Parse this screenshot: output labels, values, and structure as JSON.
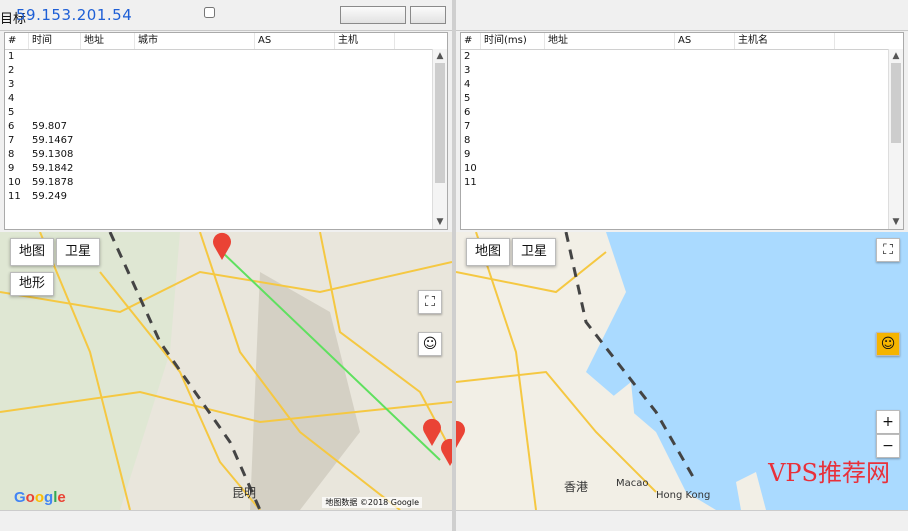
{
  "left": {
    "target_label": "目标",
    "target_ip": "59.153.201.54",
    "option_label": "",
    "buttons": {
      "trace": "",
      "stop": ""
    },
    "table": {
      "headers": [
        "#",
        "时间",
        "地址",
        "城市",
        "AS",
        "主机"
      ],
      "rows": [
        [
          "1",
          "",
          "",
          "",
          "",
          ""
        ],
        [
          "2",
          "",
          "",
          "",
          "",
          ""
        ],
        [
          "3",
          "",
          "",
          "",
          "",
          ""
        ],
        [
          "4",
          "",
          "",
          "",
          "",
          ""
        ],
        [
          "5",
          "",
          "",
          "",
          "",
          ""
        ],
        [
          "6",
          "59.807",
          "",
          "",
          "",
          ""
        ],
        [
          "7",
          "59.1467",
          "",
          "",
          "",
          ""
        ],
        [
          "8",
          "59.1308",
          "",
          "",
          "",
          ""
        ],
        [
          "9",
          "59.1842",
          "",
          "",
          "",
          ""
        ],
        [
          "10",
          "59.1878",
          "",
          "",
          "",
          ""
        ],
        [
          "11",
          "59.249",
          "",
          "",
          "",
          ""
        ]
      ]
    },
    "map": {
      "map_button": "地图",
      "satellite_button": "卫星",
      "terrain_label": "地形",
      "cities": [
        "昆明"
      ],
      "copyright": "地图数据 ©2018 Google",
      "status": ""
    }
  },
  "right": {
    "title": "",
    "mid_text": "",
    "right_text": "",
    "table": {
      "headers": [
        "#",
        "时间(ms)",
        "地址",
        "AS",
        "主机名"
      ],
      "rows": [
        [
          "2",
          "",
          "",
          "",
          ""
        ],
        [
          "3",
          "",
          "",
          "",
          ""
        ],
        [
          "4",
          "",
          "",
          "",
          ""
        ],
        [
          "5",
          "",
          "",
          "",
          ""
        ],
        [
          "6",
          "",
          "",
          "",
          ""
        ],
        [
          "7",
          "",
          "",
          "",
          ""
        ],
        [
          "8",
          "",
          "",
          "",
          ""
        ],
        [
          "9",
          "",
          "",
          "",
          ""
        ],
        [
          "10",
          "",
          "",
          "",
          ""
        ],
        [
          "11",
          "",
          "",
          "",
          ""
        ]
      ]
    },
    "map": {
      "map_button": "地图",
      "satellite_button": "卫星",
      "cities": [
        "香港",
        "Macao",
        "Hong Kong"
      ],
      "status": "",
      "watermark": "VPS推荐网"
    }
  },
  "colors": {
    "route_line": "#5fe05f",
    "pin": "#ea4335",
    "ocean": "#aadaff",
    "land": "#f2efe6",
    "accent": "#1e5fd6"
  },
  "icons": {
    "pegman": "pegman-icon",
    "zoom_in": "plus-icon",
    "zoom_out": "minus-icon",
    "fullscreen": "fullscreen-icon"
  }
}
